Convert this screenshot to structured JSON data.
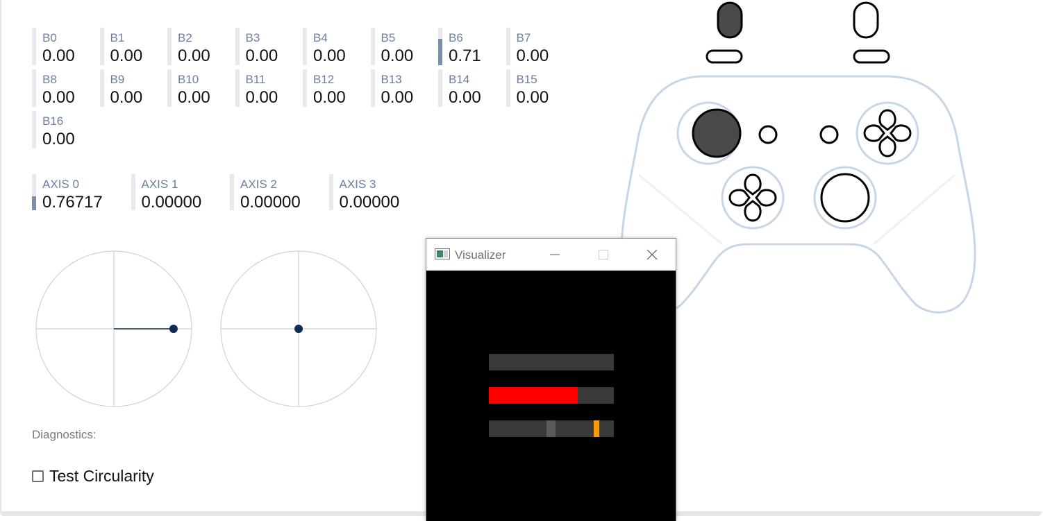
{
  "buttons": [
    {
      "label": "B0",
      "value": "0.00",
      "level": 0
    },
    {
      "label": "B1",
      "value": "0.00",
      "level": 0
    },
    {
      "label": "B2",
      "value": "0.00",
      "level": 0
    },
    {
      "label": "B3",
      "value": "0.00",
      "level": 0
    },
    {
      "label": "B4",
      "value": "0.00",
      "level": 0
    },
    {
      "label": "B5",
      "value": "0.00",
      "level": 0
    },
    {
      "label": "B6",
      "value": "0.71",
      "level": 0.71
    },
    {
      "label": "B7",
      "value": "0.00",
      "level": 0
    },
    {
      "label": "B8",
      "value": "0.00",
      "level": 0
    },
    {
      "label": "B9",
      "value": "0.00",
      "level": 0
    },
    {
      "label": "B10",
      "value": "0.00",
      "level": 0
    },
    {
      "label": "B11",
      "value": "0.00",
      "level": 0
    },
    {
      "label": "B12",
      "value": "0.00",
      "level": 0
    },
    {
      "label": "B13",
      "value": "0.00",
      "level": 0
    },
    {
      "label": "B14",
      "value": "0.00",
      "level": 0
    },
    {
      "label": "B15",
      "value": "0.00",
      "level": 0
    },
    {
      "label": "B16",
      "value": "0.00",
      "level": 0
    }
  ],
  "axes": [
    {
      "label": "AXIS 0",
      "value": "0.76717",
      "level": 0.38
    },
    {
      "label": "AXIS 1",
      "value": "0.00000",
      "level": 0
    },
    {
      "label": "AXIS 2",
      "value": "0.00000",
      "level": 0
    },
    {
      "label": "AXIS 3",
      "value": "0.00000",
      "level": 0
    }
  ],
  "sticks": [
    {
      "x": 0.76717,
      "y": 0
    },
    {
      "x": 0,
      "y": 0
    }
  ],
  "diagnostics": {
    "label": "Diagnostics:",
    "test_circularity_label": "Test Circularity",
    "test_circularity_checked": false
  },
  "visualizer": {
    "title": "Visualizer",
    "bars": [
      {
        "fill": 0,
        "color": "#ff0000"
      },
      {
        "fill": 0.71,
        "color": "#ff0000"
      },
      {
        "center_marker": 0.5,
        "value_marker": 0.86,
        "marker_color": "#ff9900"
      }
    ]
  },
  "colors": {
    "meter_fill": "#7b8fa8",
    "stick_dot": "#0d2b52",
    "controller_outline": "#c6d6e6",
    "pressed_fill": "#4a4a4a"
  },
  "controller": {
    "left_trigger_pressed": true,
    "left_stick_pressed": true
  }
}
